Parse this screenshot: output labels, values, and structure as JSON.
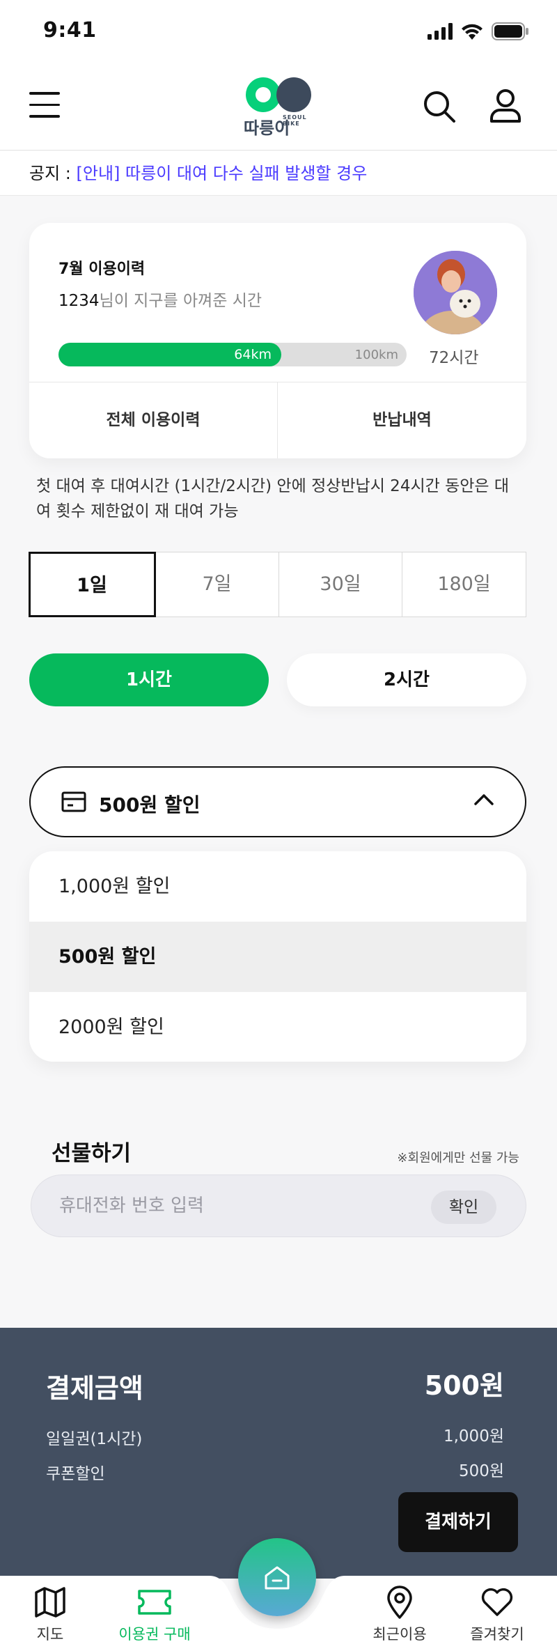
{
  "status_bar": {
    "time": "9:41"
  },
  "header": {
    "logo_text": "따릉이",
    "logo_sub1": "SEOUL",
    "logo_sub2": "BIKE",
    "brand_colors": {
      "green": "#06b95c",
      "navy": "#3d4a5c"
    }
  },
  "notice": {
    "label": "공지 : ",
    "link_text": "[안내] 따릉이 대여 다수 실패 발생할 경우"
  },
  "usage": {
    "title": "7월 이용이력",
    "user_count": "1234",
    "subtitle_rest": "님이 지구를 아껴준 시간",
    "distance_value": "64km",
    "distance_max": "100km",
    "distance_fraction": 0.64,
    "hours": "72시간",
    "btn_all_history": "전체 이용이력",
    "btn_return_history": "반납내역"
  },
  "rule_text": "첫 대여 후 대여시간 (1시간/2시간) 안에 정상반납시 24시간 동안은 대여 횟수 제한없이 재 대여 가능",
  "period_tabs": [
    "1일",
    "7일",
    "30일",
    "180일"
  ],
  "hour_options": {
    "one": "1시간",
    "two": "2시간"
  },
  "coupon": {
    "selected": "500원 할인",
    "options": [
      "1,000원 할인",
      "500원 할인",
      "2000원 할인"
    ]
  },
  "gift": {
    "title": "선물하기",
    "note": "※회원에게만 선물 가능",
    "placeholder": "휴대전화 번호 입력",
    "confirm": "확인"
  },
  "payment": {
    "title": "결제금액",
    "total": "500원",
    "row1_label": "일일권(1시간)",
    "row1_value": "1,000원",
    "row2_label": "쿠폰할인",
    "row2_value": "500원",
    "pay_button": "결제하기"
  },
  "bottom_nav": {
    "map": "지도",
    "ticket": "이용권 구매",
    "recent": "최근이용",
    "favorites": "즐겨찾기"
  }
}
